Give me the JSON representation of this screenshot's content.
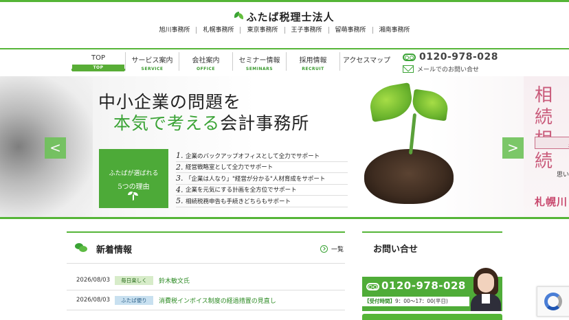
{
  "header": {
    "logo_text": "ふたば税理士法人",
    "offices": [
      "旭川事務所",
      "札幌事務所",
      "東京事務所",
      "王子事務所",
      "留萌事務所",
      "湘南事務所"
    ]
  },
  "nav": {
    "items": [
      {
        "jp": "TOP",
        "en": "TOP"
      },
      {
        "jp": "サービス案内",
        "en": "SERVICE"
      },
      {
        "jp": "会社案内",
        "en": "OFFICE"
      },
      {
        "jp": "セミナー情報",
        "en": "SEMINARS"
      },
      {
        "jp": "採用情報",
        "en": "RECRUIT"
      },
      {
        "jp": "アクセスマップ",
        "en": ""
      }
    ],
    "tel": "0120-978-028",
    "mail_label": "メールでのお問い合せ"
  },
  "hero": {
    "line1": "中小企業の問題を",
    "line2_green": "本気で考える",
    "line2_rest": "会計事務所",
    "reasons_box_line1": "ふたばが選ばれる",
    "reasons_box_line2": "5つの理由",
    "reasons": [
      {
        "num": "1.",
        "text": "企業のバックアップオフィスとして全力でサポート"
      },
      {
        "num": "2.",
        "text": "経営戦略室として全力でサポート"
      },
      {
        "num": "3.",
        "text": "「企業は人なり」\"経営が分かる\"人材育成をサポート"
      },
      {
        "num": "4.",
        "text": "企業を元気にする計画を全方位でサポート"
      },
      {
        "num": "5.",
        "text": "相続税務申告も手続きどちらもサポート"
      }
    ],
    "prev_arrow": "<",
    "next_arrow": ">",
    "peek_title": "相続\n相続",
    "peek_band": "札",
    "peek_sub": "思い",
    "peek_city": "札幌川"
  },
  "news": {
    "title": "新着情報",
    "list_link": "一覧",
    "rows": [
      {
        "date": "2026/08/03",
        "tag": "毎日楽しく",
        "title": "鈴木敏文氏"
      },
      {
        "date": "2026/08/03",
        "tag": "ふたば便り",
        "title": "消費税インボイス制度の経過措置の見直し"
      }
    ]
  },
  "inquiry": {
    "title": "お問い合せ",
    "tel": "0120-978-028",
    "hours_label": "【受付時間】",
    "hours_value": "9：00〜17：00(平日)"
  },
  "colors": {
    "brand_green": "#55b537",
    "link_green": "#2b8a22",
    "accent_pink": "#c94a6f"
  }
}
